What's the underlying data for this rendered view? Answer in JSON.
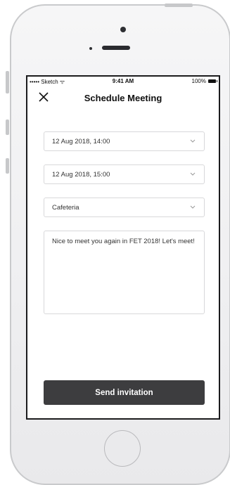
{
  "status_bar": {
    "carrier": "••••• Sketch ᯤ",
    "time": "9:41 AM",
    "battery": "100%"
  },
  "nav": {
    "title": "Schedule Meeting",
    "close_icon": "close-icon"
  },
  "form": {
    "start_time": "12 Aug 2018, 14:00",
    "end_time": "12 Aug 2018, 15:00",
    "location": "Cafeteria",
    "message": "Nice to meet you again in FET 2018! Let's meet!",
    "chevron_icon": "chevron-down-icon"
  },
  "actions": {
    "send_label": "Send invitation"
  },
  "colors": {
    "button_bg": "#3d3d3f",
    "border": "#d8d8da",
    "phone_body": "#f2f2f4"
  }
}
